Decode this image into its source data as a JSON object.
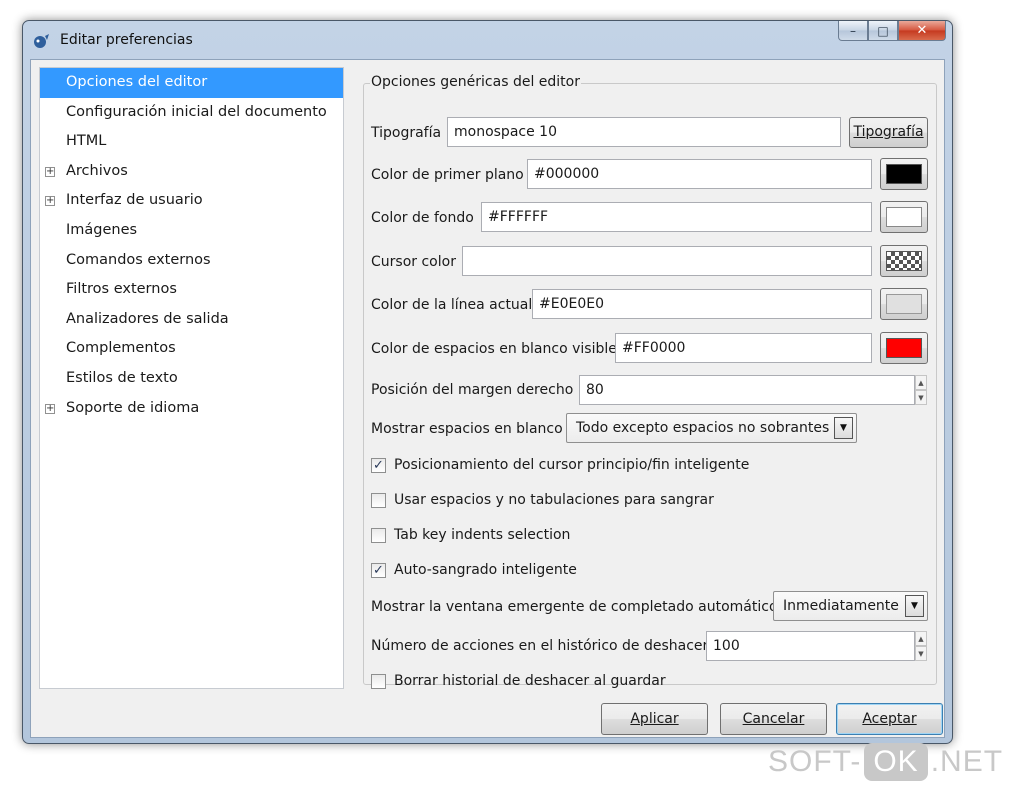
{
  "window": {
    "title": "Editar preferencias",
    "icon": "bluefish-app-icon",
    "controls": {
      "minimize": "–",
      "maximize": "□",
      "close": "✕"
    }
  },
  "sidebar": {
    "items": [
      {
        "label": "Opciones del editor",
        "expandable": false,
        "selected": true
      },
      {
        "label": "Configuración inicial del documento",
        "expandable": false
      },
      {
        "label": "HTML",
        "expandable": false
      },
      {
        "label": "Archivos",
        "expandable": true
      },
      {
        "label": "Interfaz de usuario",
        "expandable": true
      },
      {
        "label": "Imágenes",
        "expandable": false
      },
      {
        "label": "Comandos externos",
        "expandable": false
      },
      {
        "label": "Filtros externos",
        "expandable": false
      },
      {
        "label": "Analizadores de salida",
        "expandable": false
      },
      {
        "label": "Complementos",
        "expandable": false
      },
      {
        "label": "Estilos de texto",
        "expandable": false
      },
      {
        "label": "Soporte de idioma",
        "expandable": true
      }
    ],
    "expander_glyph": "+"
  },
  "editor_options": {
    "group_title": "Opciones genéricas del editor",
    "font": {
      "label": "Tipografía",
      "value": "monospace 10",
      "button": "Tipografía"
    },
    "foreground": {
      "label": "Color de primer plano",
      "value": "#000000",
      "swatch": "#000000"
    },
    "background": {
      "label": "Color de fondo",
      "value": "#FFFFFF",
      "swatch": "#FFFFFF"
    },
    "cursor": {
      "label": "Cursor color",
      "value": "",
      "swatch": "checker"
    },
    "current_line": {
      "label": "Color de la línea actual",
      "value": "#E0E0E0",
      "swatch": "#E0E0E0"
    },
    "visible_whitespace": {
      "label": "Color de espacios en blanco visible",
      "value": "#FF0000",
      "swatch": "#FF0000"
    },
    "right_margin": {
      "label": "Posición del margen derecho",
      "value": "80"
    },
    "show_whitespace": {
      "label": "Mostrar espacios en blanco",
      "value": "Todo excepto espacios no sobrantes"
    },
    "smart_home_end": {
      "label": "Posicionamiento del cursor principio/fin inteligente",
      "checked": true
    },
    "spaces_for_tabs": {
      "label": "Usar espacios y no tabulaciones para sangrar",
      "checked": false
    },
    "tab_indents": {
      "label": "Tab key indents selection",
      "checked": false
    },
    "smart_autoindent": {
      "label": "Auto-sangrado inteligente",
      "checked": true
    },
    "autocomplete_popup": {
      "label": "Mostrar la ventana emergente de completado automático",
      "value": "Inmediatamente"
    },
    "undo_history": {
      "label": "Número de acciones en el histórico de deshacer",
      "value": "100"
    },
    "clear_undo_on_save": {
      "label": "Borrar historial de deshacer al guardar",
      "checked": false
    },
    "check_glyph": "✓",
    "spin_up": "▲",
    "spin_down": "▼",
    "combo_arrow": "▼"
  },
  "buttons": {
    "apply": "Aplicar",
    "cancel": "Cancelar",
    "accept": "Aceptar"
  },
  "watermark": {
    "left": "SOFT-",
    "box": "OK",
    "right": ".NET"
  }
}
